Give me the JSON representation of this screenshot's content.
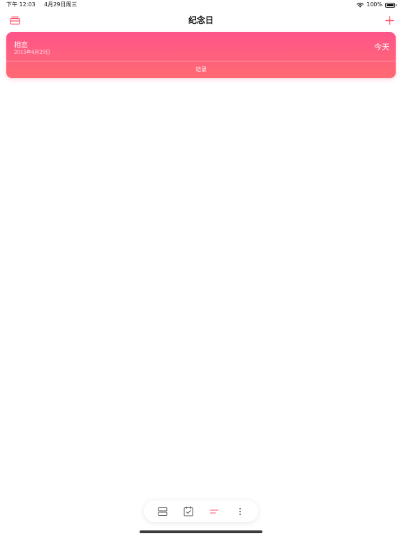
{
  "status_bar": {
    "time": "下午 12:03",
    "date": "4月29日周三",
    "battery": "100%"
  },
  "nav": {
    "title": "纪念日",
    "left_icon": "archive-icon",
    "right_icon": "plus-icon"
  },
  "anniversary_card": {
    "name": "相恋",
    "date": "2015年4月29日",
    "days": "今天",
    "action_label": "记录",
    "gradient_top": "#fe5589",
    "gradient_bottom": "#fe6a72"
  },
  "toolbar": {
    "items": [
      {
        "icon": "list-view-icon",
        "active": false
      },
      {
        "icon": "calendar-check-icon",
        "active": false
      },
      {
        "icon": "sort-icon",
        "active": true
      },
      {
        "icon": "more-icon",
        "active": false
      }
    ]
  },
  "colors": {
    "accent": "#fd4c63"
  }
}
